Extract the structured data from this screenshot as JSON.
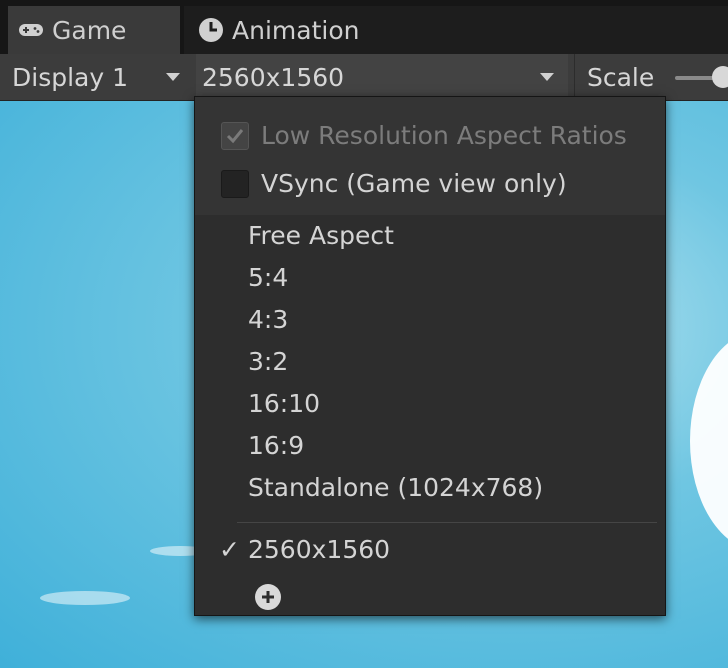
{
  "tabs": [
    {
      "label": "Game",
      "icon": "gamepad-icon",
      "active": true
    },
    {
      "label": "Animation",
      "icon": "clock-icon",
      "active": false
    }
  ],
  "toolbar": {
    "display_label": "Display 1",
    "resolution_label": "2560x1560",
    "scale_label": "Scale"
  },
  "menu": {
    "options": [
      {
        "label": "Low Resolution Aspect Ratios",
        "checked": true,
        "enabled": false
      },
      {
        "label": "VSync (Game view only)",
        "checked": false,
        "enabled": true
      }
    ],
    "aspects": [
      "Free Aspect",
      "5:4",
      "4:3",
      "3:2",
      "16:10",
      "16:9",
      "Standalone (1024x768)"
    ],
    "custom": {
      "label": "2560x1560",
      "selected_mark": "✓"
    }
  },
  "colors": {
    "panel": "#2d2d2d",
    "toolbar": "#3c3c3c",
    "sky": "#6fc6e2"
  }
}
